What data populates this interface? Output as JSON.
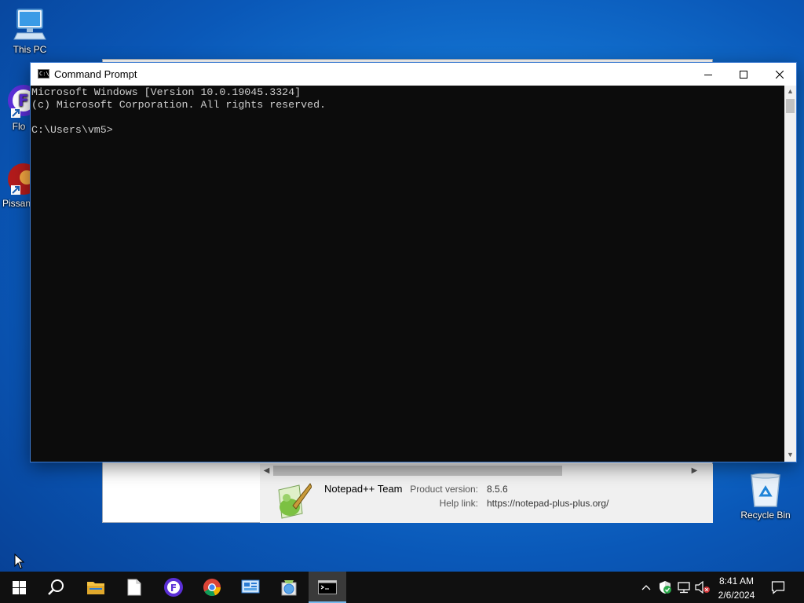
{
  "desktop": {
    "icons": [
      {
        "label": "This PC",
        "name": "this-pc"
      },
      {
        "label": "Flo",
        "name": "flo"
      },
      {
        "label": "Pissanc",
        "name": "pissanc"
      },
      {
        "label": "Recycle Bin",
        "name": "recycle-bin"
      }
    ]
  },
  "notepad_about": {
    "team": "Notepad++ Team",
    "product_version_label": "Product version:",
    "product_version": "8.5.6",
    "help_link_label": "Help link:",
    "help_link": "https://notepad-plus-plus.org/"
  },
  "cmd": {
    "title": "Command Prompt",
    "icon_text": "C:\\",
    "lines": [
      "Microsoft Windows [Version 10.0.19045.3324]",
      "(c) Microsoft Corporation. All rights reserved.",
      "",
      "C:\\Users\\vm5>"
    ]
  },
  "taskbar": {
    "pinned": [
      "start",
      "search",
      "file-explorer",
      "notepad",
      "flo-app",
      "chrome",
      "control-panel",
      "image-viewer",
      "command-prompt"
    ],
    "active": "command-prompt",
    "clock_time": "8:41 AM",
    "clock_date": "2/6/2024"
  },
  "colors": {
    "console_bg": "#0c0c0c",
    "console_text": "#cccccc",
    "taskbar_bg": "#101010",
    "accent": "#76b9ed"
  }
}
